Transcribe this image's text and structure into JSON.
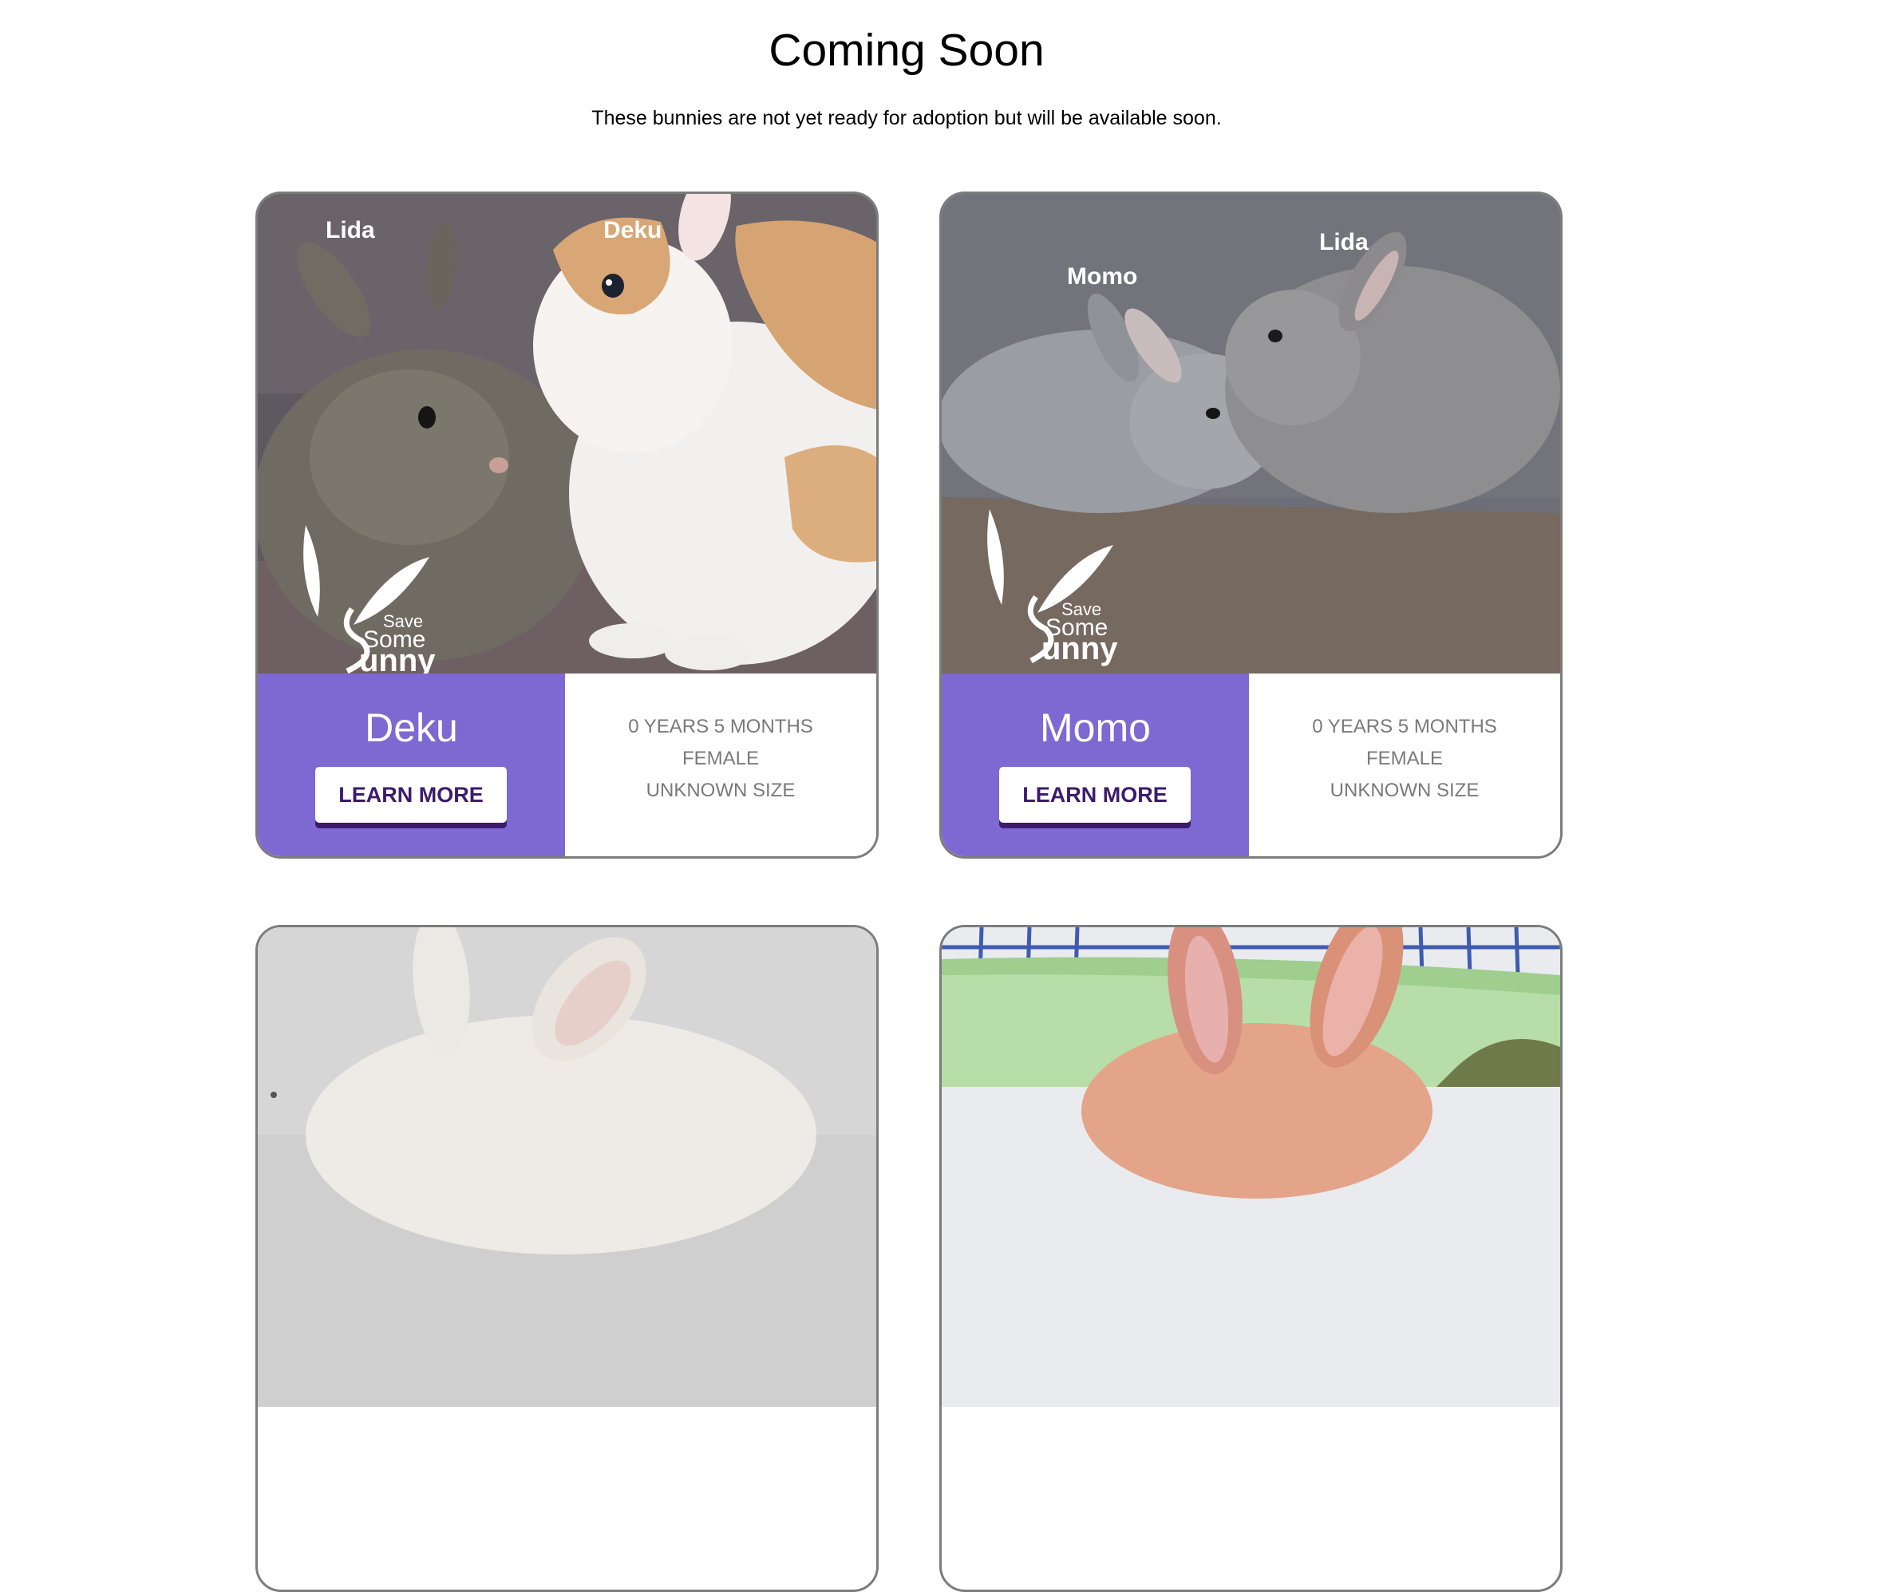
{
  "header": {
    "title": "Coming Soon",
    "subtitle": "These bunnies are not yet ready for adoption but will be available soon."
  },
  "cards": [
    {
      "name": "Deku",
      "button": "LEARN MORE",
      "age": "0 YEARS 5 MONTHS",
      "sex": "FEMALE",
      "size": "UNKNOWN SIZE",
      "photo_labels": [
        "Lida",
        "Deku"
      ],
      "watermark": [
        "Save",
        "Some",
        "unny"
      ]
    },
    {
      "name": "Momo",
      "button": "LEARN MORE",
      "age": "0 YEARS 5 MONTHS",
      "sex": "FEMALE",
      "size": "UNKNOWN SIZE",
      "photo_labels": [
        "Momo",
        "Lida"
      ],
      "watermark": [
        "Save",
        "Some",
        "unny"
      ]
    },
    {},
    {}
  ],
  "colors": {
    "name_panel": "#7d69d1",
    "button_text": "#3d1b6c",
    "info_text": "#7a7a7a",
    "card_border": "#7c7c7c"
  }
}
